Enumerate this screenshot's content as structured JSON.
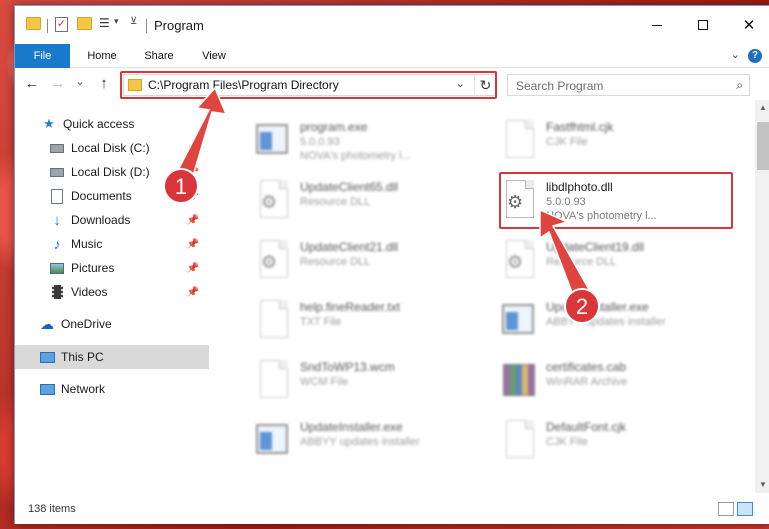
{
  "window": {
    "title": "Program"
  },
  "ribbon": {
    "tabs": [
      "File",
      "Home",
      "Share",
      "View"
    ],
    "help": "?"
  },
  "nav": {
    "back": "←",
    "forward": "→",
    "recent": "⌄",
    "up": "↑",
    "address": "C:\\Program Files\\Program Directory",
    "refresh": "↻",
    "search_placeholder": "Search Program"
  },
  "sidebar": {
    "items": [
      {
        "label": "Quick access",
        "icon": "star-icon"
      },
      {
        "label": "Local Disk (C:)",
        "icon": "drive-icon",
        "pinned": true
      },
      {
        "label": "Local Disk (D:)",
        "icon": "drive-icon",
        "pinned": true
      },
      {
        "label": "Documents",
        "icon": "documents-icon",
        "pinned": true
      },
      {
        "label": "Downloads",
        "icon": "download-arrow-icon",
        "pinned": true
      },
      {
        "label": "Music",
        "icon": "music-note-icon",
        "pinned": true
      },
      {
        "label": "Pictures",
        "icon": "pictures-icon",
        "pinned": true
      },
      {
        "label": "Videos",
        "icon": "film-icon",
        "pinned": true
      },
      {
        "label": "OneDrive",
        "icon": "cloud-icon"
      },
      {
        "label": "This PC",
        "icon": "monitor-icon",
        "selected": true
      },
      {
        "label": "Network",
        "icon": "network-icon"
      }
    ]
  },
  "files": [
    {
      "name": "program.exe",
      "sub": "5.0.0.93",
      "sub2": "NOVA's photometry l...",
      "type": "exe"
    },
    {
      "name": "Fastfhtml.cjk",
      "sub": "CJK File",
      "type": "doc"
    },
    {
      "name": "UpdateClient65.dll",
      "sub": "Resource DLL",
      "type": "dll"
    },
    {
      "name": "libdlphoto.dll",
      "sub": "5.0.0.93",
      "sub2": "NOVA's photometry l...",
      "type": "dll",
      "highlighted": true
    },
    {
      "name": "UpdateClient21.dll",
      "sub": "Resource DLL",
      "type": "dll"
    },
    {
      "name": "UpdateClient19.dll",
      "sub": "Resource DLL",
      "type": "dll"
    },
    {
      "name": "help.fineReader.txt",
      "sub": "TXT File",
      "type": "doc"
    },
    {
      "name": "UpdateInstaller.exe",
      "sub": "ABBYY updates installer",
      "type": "exe"
    },
    {
      "name": "SndToWP13.wcm",
      "sub": "WCM File",
      "type": "doc"
    },
    {
      "name": "certificates.cab",
      "sub": "WinRAR Archive",
      "type": "cab"
    },
    {
      "name": "UpdateInstaller.exe",
      "sub": "ABBYY updates installer",
      "type": "exe"
    },
    {
      "name": "DefaultFont.cjk",
      "sub": "CJK File",
      "type": "doc"
    }
  ],
  "status": {
    "count": "138 items"
  },
  "annotations": [
    "1",
    "2"
  ],
  "colors": {
    "accent": "#1979ca",
    "highlight": "#d9363a"
  }
}
